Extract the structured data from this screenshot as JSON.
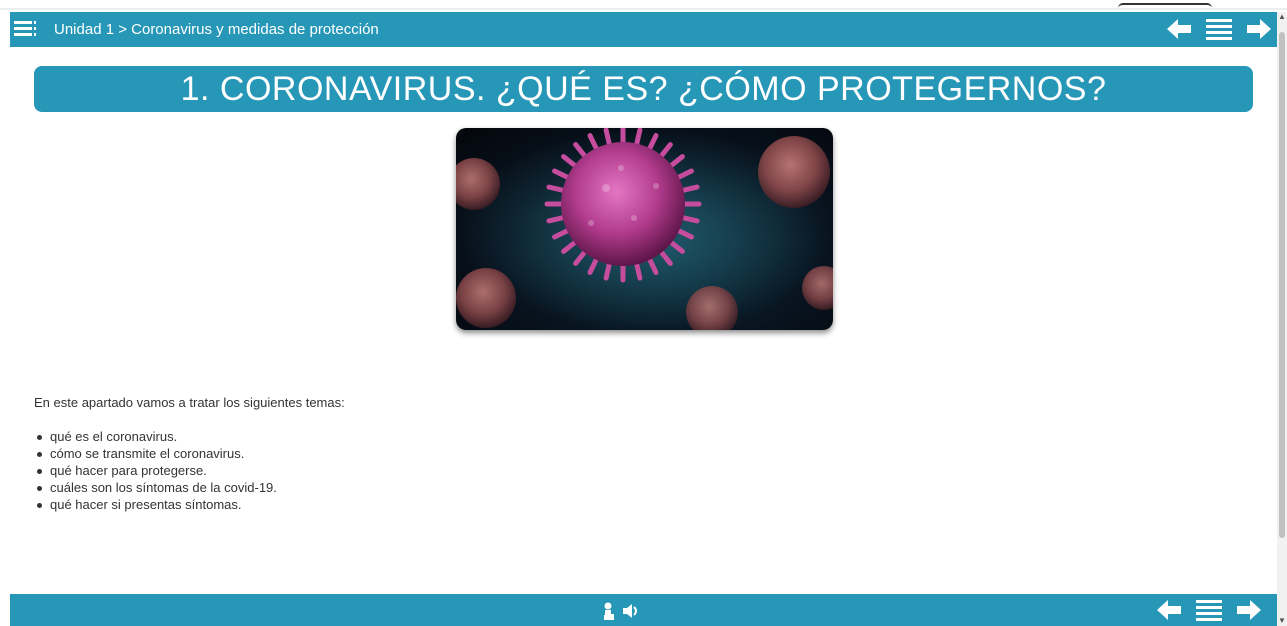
{
  "header": {
    "breadcrumb": "Unidad 1 > Coronavirus y medidas de protección",
    "menu_icon": "hamburger-menu-icon",
    "nav": [
      "arrow-left-icon",
      "index-list-icon",
      "arrow-right-icon"
    ]
  },
  "page": {
    "title": "1. CORONAVIRUS. ¿QUÉ ES? ¿CÓMO PROTEGERNOS?",
    "intro": "En este apartado vamos a tratar los siguientes temas:",
    "topics": [
      "qué es el coronavirus.",
      "cómo se transmite el coronavirus.",
      "qué hacer para protegerse.",
      "cuáles son los síntomas de la covid-19.",
      "qué hacer si presentas síntomas."
    ]
  },
  "footer": {
    "audio_icons": [
      "touch-icon",
      "speaker-icon"
    ],
    "nav": [
      "arrow-left-icon",
      "index-list-icon",
      "arrow-right-icon"
    ]
  },
  "colors": {
    "accent": "#2797b8",
    "text": "#333333"
  }
}
